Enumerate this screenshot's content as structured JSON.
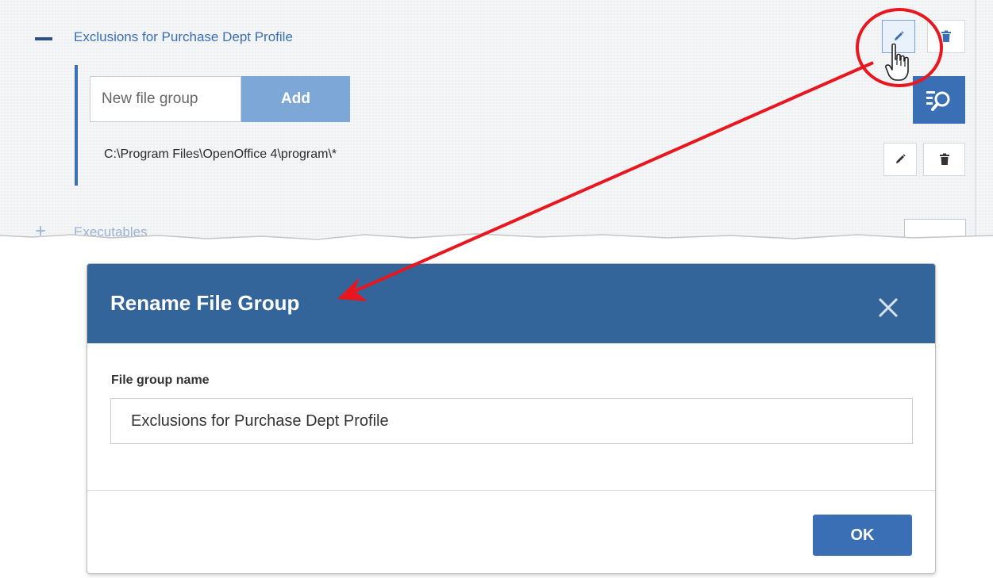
{
  "file_group": {
    "name": "Exclusions for Purchase Dept Profile",
    "new_group_placeholder": "New file group",
    "add_label": "Add",
    "file_path": "C:\\Program Files\\OpenOffice 4\\program\\*"
  },
  "next_group": {
    "expand_symbol": "+",
    "label": "Executables"
  },
  "dialog": {
    "title": "Rename File Group",
    "field_label": "File group name",
    "field_value": "Exclusions for Purchase Dept Profile",
    "ok_label": "OK"
  },
  "colors": {
    "accent": "#3a6fb5",
    "header": "#33659b",
    "add_button": "#7da7d6",
    "annotation": "#e8171f"
  },
  "icons": [
    "minus-icon",
    "pencil-icon",
    "trash-icon",
    "hand-cursor-icon",
    "search-list-icon",
    "plus-icon",
    "close-icon"
  ]
}
